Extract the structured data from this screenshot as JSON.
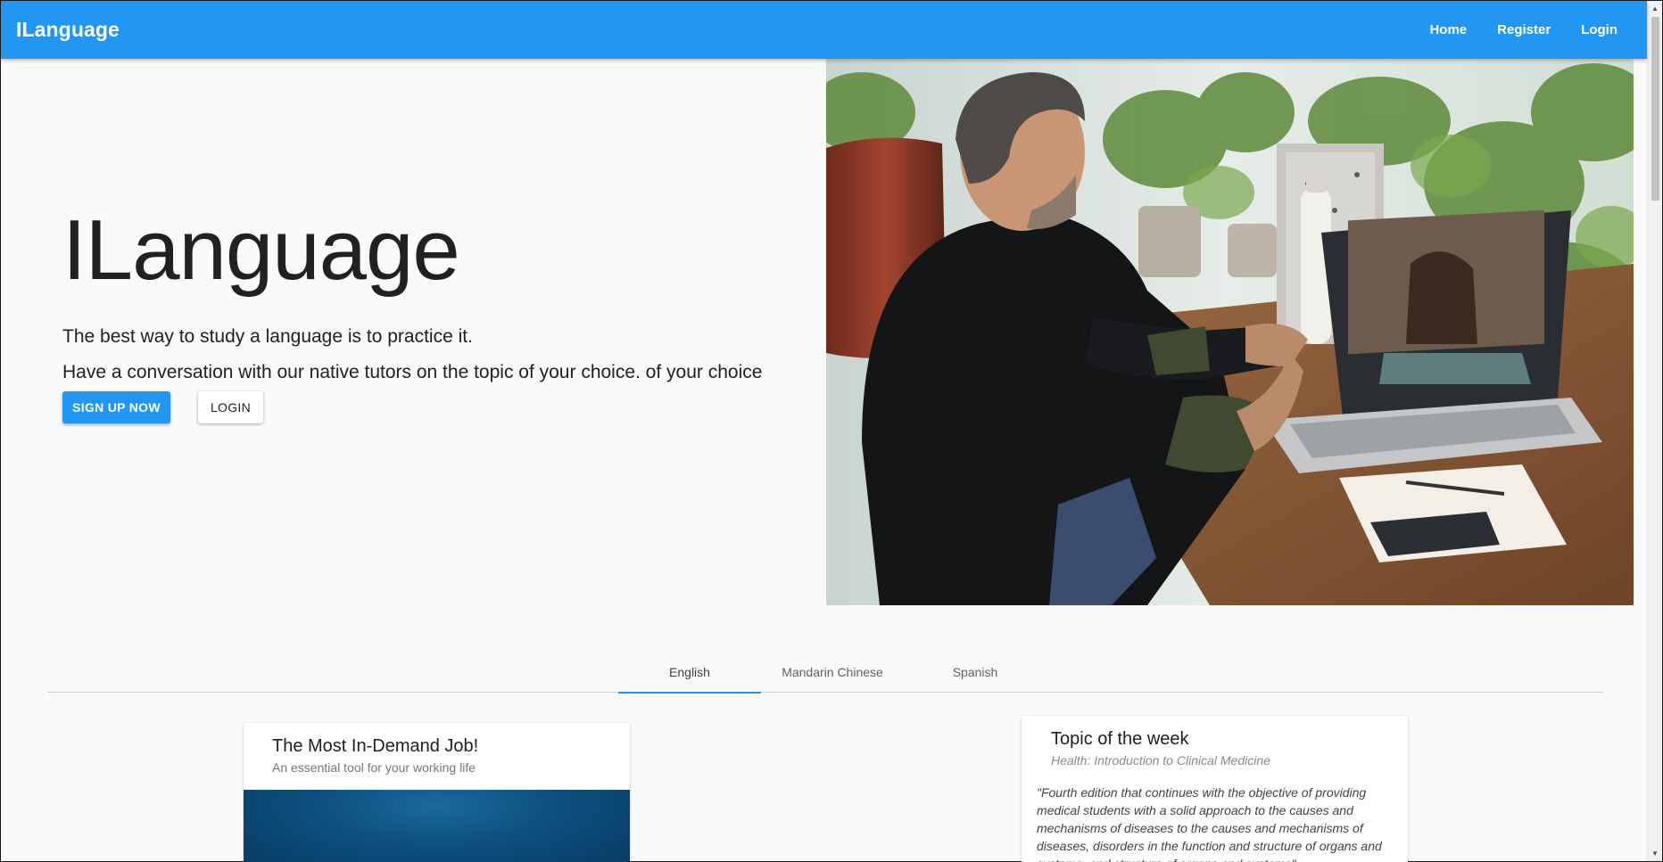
{
  "appbar": {
    "brand": "ILanguage",
    "color": "#2196f3",
    "nav": [
      {
        "label": "Home"
      },
      {
        "label": "Register"
      },
      {
        "label": "Login"
      }
    ]
  },
  "hero": {
    "title": "ILanguage",
    "line1": "The best way to study a language is to practice it.",
    "line2": "Have a conversation with our native tutors on the topic of your choice. of your choice",
    "primary_button": "SIGN UP NOW",
    "secondary_button": "LOGIN"
  },
  "tabs": [
    {
      "label": "English",
      "active": true
    },
    {
      "label": "Mandarin Chinese",
      "active": false
    },
    {
      "label": "Spanish",
      "active": false
    }
  ],
  "card_job": {
    "title": "The Most In-Demand Job!",
    "subtitle": "An essential tool for your working life"
  },
  "card_topic": {
    "title": "Topic of the week",
    "subtitle": "Health: Introduction to Clinical Medicine",
    "body": "\"Fourth edition that continues with the objective of providing medical students with a solid approach to the causes and mechanisms of diseases to the causes and mechanisms of diseases, disorders in the function and structure of organs and systems, and structure of organs and systems\""
  },
  "icons": {
    "scroll_up": "scroll-up-arrow-icon",
    "scroll_down": "scroll-down-arrow-icon"
  }
}
